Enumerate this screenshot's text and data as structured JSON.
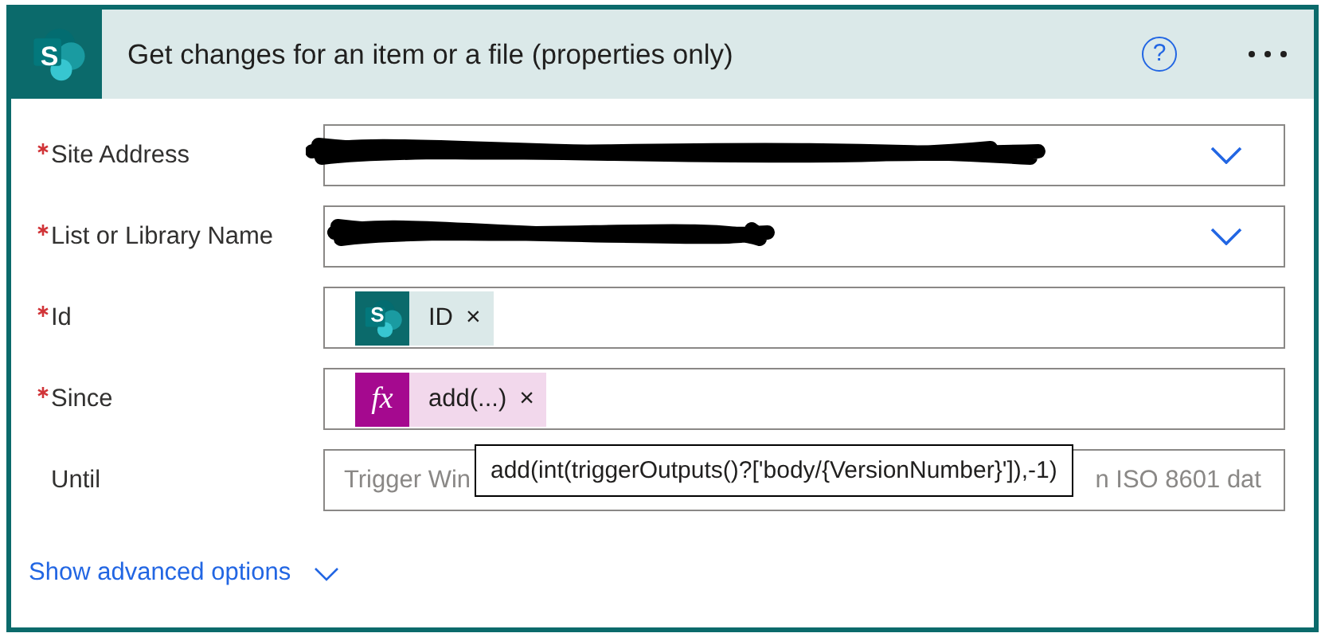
{
  "card": {
    "logo_letter": "S",
    "title": "Get changes for an item or a file (properties only)",
    "help": "?"
  },
  "parameters": [
    {
      "label": "Site Address",
      "required": true,
      "kind": "dropdown",
      "redacted": true
    },
    {
      "label": "List or Library Name",
      "required": true,
      "kind": "dropdown",
      "redacted": true
    },
    {
      "label": "Id",
      "required": true,
      "kind": "tokens",
      "tokens": [
        {
          "kind": "sharepoint",
          "badge": "S",
          "label": "ID",
          "remove": "×"
        }
      ]
    },
    {
      "label": "Since",
      "required": true,
      "kind": "tokens",
      "tokens": [
        {
          "kind": "expression",
          "badge": "fx",
          "label": "add(...)",
          "remove": "×"
        }
      ]
    },
    {
      "label": "Until",
      "required": false,
      "kind": "text",
      "placeholder_start": "Trigger Win",
      "placeholder_end": "n ISO 8601 dat"
    }
  ],
  "tooltip": "add(int(triggerOutputs()?['body/{VersionNumber}']),-1)",
  "advanced": {
    "label": "Show advanced options",
    "expanded": false
  }
}
